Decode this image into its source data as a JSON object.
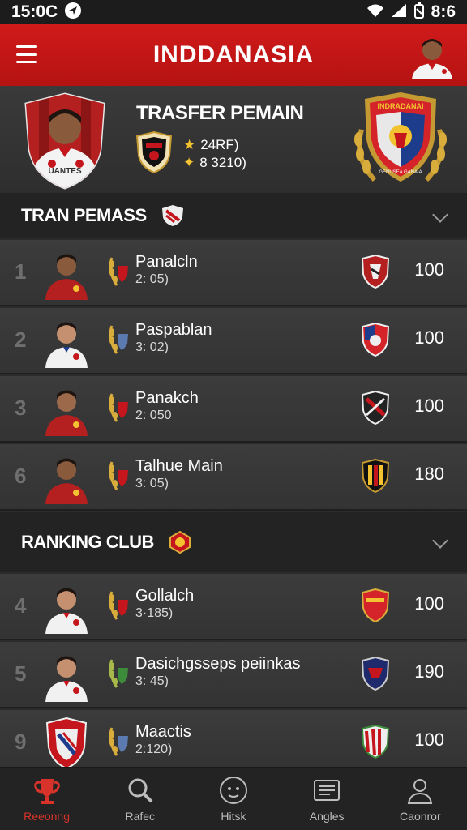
{
  "status_bar": {
    "time": "15:0C",
    "right_time": "8:6"
  },
  "header": {
    "title": "INDDANASIA"
  },
  "hero": {
    "title": "TRASFER PEMAIN",
    "stat1": "24RF)",
    "stat2": "8 3210)",
    "jersey_text": "UANTES",
    "crest_text": "INDRADANAI",
    "crest_footer": "GENUSEA GANAIA"
  },
  "section1": {
    "title": "TRAN PEMASS"
  },
  "section2": {
    "title": "RANKING CLUB"
  },
  "players": [
    {
      "rank": "1",
      "name": "Panalcln",
      "stat": "2: 05)",
      "score": "100"
    },
    {
      "rank": "2",
      "name": "Paspablan",
      "stat": "3: 02)",
      "score": "100"
    },
    {
      "rank": "3",
      "name": "Panakch",
      "stat": "2: 050",
      "score": "100"
    },
    {
      "rank": "6",
      "name": "Talhue Main",
      "stat": "3: 05)",
      "score": "180"
    }
  ],
  "clubs": [
    {
      "rank": "4",
      "name": "Gollalch",
      "stat": "3·185)",
      "score": "100"
    },
    {
      "rank": "5",
      "name": "Dasichgsseps peiinkas",
      "stat": "3: 45)",
      "score": "190"
    },
    {
      "rank": "9",
      "name": "Maactis",
      "stat": "2:120)",
      "score": "100"
    }
  ],
  "nav": [
    {
      "label": "Reeonng",
      "icon": "trophy-icon",
      "active": true
    },
    {
      "label": "Rafec",
      "icon": "search-icon"
    },
    {
      "label": "Hitsk",
      "icon": "ball-icon"
    },
    {
      "label": "Angles",
      "icon": "news-icon"
    },
    {
      "label": "Caonror",
      "icon": "profile-icon"
    }
  ],
  "colors": {
    "brand_red": "#c4161c",
    "accent_gold": "#f2c230",
    "background": "#2b2b2b"
  }
}
